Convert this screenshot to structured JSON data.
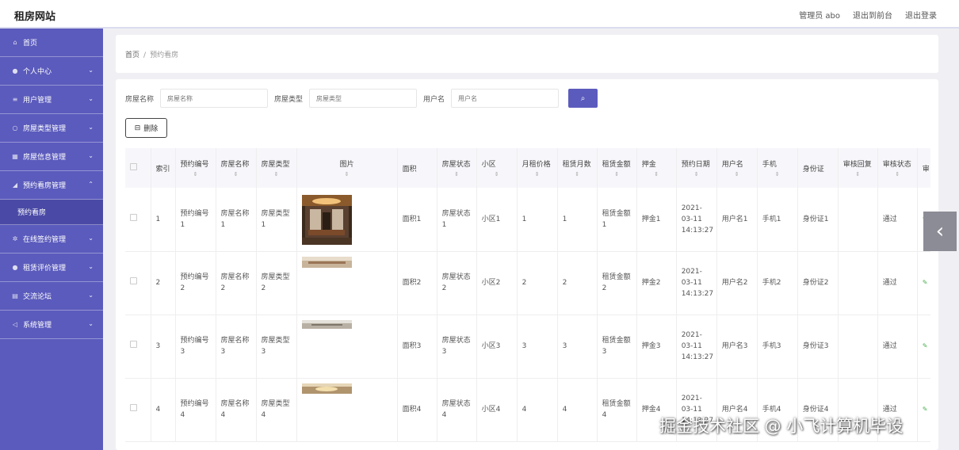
{
  "app": {
    "title": "租房网站"
  },
  "topnav": {
    "admin": "管理员 abo",
    "front": "退出到前台",
    "logout": "退出登录"
  },
  "sidebar": [
    {
      "icon": "home-icon",
      "glyph": "⌂",
      "label": "首页",
      "chevron": ""
    },
    {
      "icon": "user-icon",
      "glyph": "●",
      "label": "个人中心",
      "chevron": "⌄"
    },
    {
      "icon": "list-icon",
      "glyph": "≡",
      "label": "用户管理",
      "chevron": "⌄"
    },
    {
      "icon": "circle-icon",
      "glyph": "○",
      "label": "房屋类型管理",
      "chevron": "⌄"
    },
    {
      "icon": "building-icon",
      "glyph": "▦",
      "label": "房屋信息管理",
      "chevron": "⌄"
    },
    {
      "icon": "send-icon",
      "glyph": "◢",
      "label": "预约看房管理",
      "chevron": "⌃"
    }
  ],
  "sidebar_sub": {
    "label": "预约看房"
  },
  "sidebar_rest": [
    {
      "icon": "gear-icon",
      "glyph": "✲",
      "label": "在线签约管理",
      "chevron": "⌄"
    },
    {
      "icon": "user-icon",
      "glyph": "●",
      "label": "租赁评价管理",
      "chevron": "⌄"
    },
    {
      "icon": "chat-icon",
      "glyph": "▤",
      "label": "交流论坛",
      "chevron": "⌄"
    },
    {
      "icon": "plane-icon",
      "glyph": "◁",
      "label": "系统管理",
      "chevron": "⌄"
    }
  ],
  "breadcrumb": {
    "home": "首页",
    "sep": "/",
    "current": "预约看房"
  },
  "search": {
    "name_label": "房屋名称",
    "name_placeholder": "房屋名称",
    "type_label": "房屋类型",
    "type_placeholder": "房屋类型",
    "user_label": "用户名",
    "user_placeholder": "用户名"
  },
  "delete_button": "删除",
  "table": {
    "headers": [
      "索引",
      "预约编号",
      "房屋名称",
      "房屋类型",
      "图片",
      "面积",
      "房屋状态",
      "小区",
      "月租价格",
      "租赁月数",
      "租赁金额",
      "押金",
      "预约日期",
      "用户名",
      "手机",
      "身份证",
      "审核回复",
      "审核状态",
      "审"
    ],
    "rows": [
      {
        "idx": "1",
        "no": "预约编号1",
        "name": "房屋名称1",
        "type": "房屋类型1",
        "area": "面积1",
        "status": "房屋状态1",
        "community": "小区1",
        "rent": "1",
        "months": "1",
        "amount": "租赁金额1",
        "deposit": "押金1",
        "date": "2021-03-11 14:13:27",
        "user": "用户名1",
        "phone": "手机1",
        "idcard": "身份证1",
        "reply": "",
        "audit": "通过"
      },
      {
        "idx": "2",
        "no": "预约编号2",
        "name": "房屋名称2",
        "type": "房屋类型2",
        "area": "面积2",
        "status": "房屋状态2",
        "community": "小区2",
        "rent": "2",
        "months": "2",
        "amount": "租赁金额2",
        "deposit": "押金2",
        "date": "2021-03-11 14:13:27",
        "user": "用户名2",
        "phone": "手机2",
        "idcard": "身份证2",
        "reply": "",
        "audit": "通过"
      },
      {
        "idx": "3",
        "no": "预约编号3",
        "name": "房屋名称3",
        "type": "房屋类型3",
        "area": "面积3",
        "status": "房屋状态3",
        "community": "小区3",
        "rent": "3",
        "months": "3",
        "amount": "租赁金额3",
        "deposit": "押金3",
        "date": "2021-03-11 14:13:27",
        "user": "用户名3",
        "phone": "手机3",
        "idcard": "身份证3",
        "reply": "",
        "audit": "通过"
      },
      {
        "idx": "4",
        "no": "预约编号4",
        "name": "房屋名称4",
        "type": "房屋类型4",
        "area": "面积4",
        "status": "房屋状态4",
        "community": "小区4",
        "rent": "4",
        "months": "4",
        "amount": "租赁金额4",
        "deposit": "押金4",
        "date": "2021-03-11 14:13:27",
        "user": "用户名4",
        "phone": "手机4",
        "idcard": "身份证4",
        "reply": "",
        "audit": "通过"
      }
    ]
  },
  "colors": {
    "accent": "#5b5bbd",
    "sidebar_sub": "#4a4aa6"
  },
  "watermark": "掘金技术社区 @ 小飞计算机毕设"
}
